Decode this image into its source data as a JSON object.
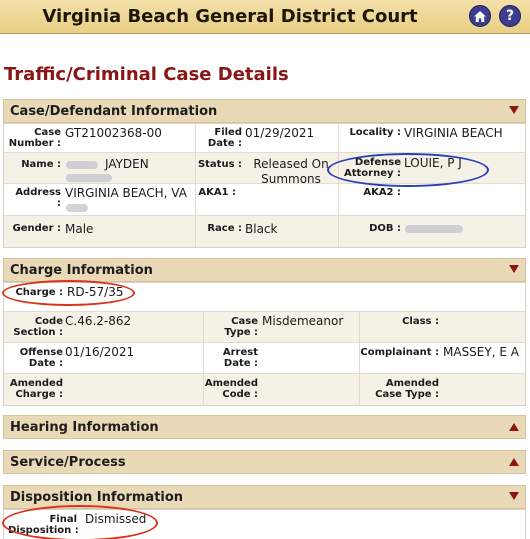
{
  "header": {
    "title": "Virginia Beach General District Court",
    "home_icon": "home-icon",
    "help_icon": "help-icon",
    "help_glyph": "?",
    "bar_color": "#ecd48f"
  },
  "page_title": "Traffic/Criminal Case Details",
  "sections": {
    "case_defendant": {
      "title": "Case/Defendant Information",
      "case_number_label": "Case\nNumber :",
      "case_number": "GT21002368-00",
      "filed_date_label": "Filed\nDate :",
      "filed_date": "01/29/2021",
      "locality_label": "Locality :",
      "locality": "VIRGINIA BEACH",
      "name_label": "Name :",
      "name": "JAYDEN",
      "status_label": "Status :",
      "status": "Released On Summons",
      "defense_attorney_label": "Defense\nAttorney :",
      "defense_attorney": "LOUIE, P J",
      "address_label": "Address :",
      "address": "VIRGINIA BEACH, VA",
      "aka1_label": "AKA1 :",
      "aka2_label": "AKA2 :",
      "gender_label": "Gender :",
      "gender": "Male",
      "race_label": "Race :",
      "race": "Black",
      "dob_label": "DOB :"
    },
    "charge": {
      "title": "Charge Information",
      "charge_label": "Charge :",
      "charge": "RD-57/35",
      "code_section_label": "Code\nSection :",
      "code_section": "C.46.2-862",
      "case_type_label": "Case\nType :",
      "case_type": "Misdemeanor",
      "class_label": "Class :",
      "offense_date_label": "Offense\nDate :",
      "offense_date": "01/16/2021",
      "arrest_date_label": "Arrest\nDate :",
      "complainant_label": "Complainant :",
      "complainant": "MASSEY, E A",
      "amended_charge_label": "Amended\nCharge :",
      "amended_code_label": "Amended\nCode :",
      "amended_case_type_label": "Amended\nCase Type :"
    },
    "hearing": {
      "title": "Hearing Information"
    },
    "service": {
      "title": "Service/Process"
    },
    "disposition": {
      "title": "Disposition Information",
      "final_disposition_label": "Final\nDisposition :",
      "final_disposition": "Dismissed"
    }
  },
  "colors": {
    "accent": "#8b1414",
    "section_bg": "#ead9b7",
    "highlight_blue": "#2a3fb5",
    "highlight_red": "#d8341c"
  }
}
